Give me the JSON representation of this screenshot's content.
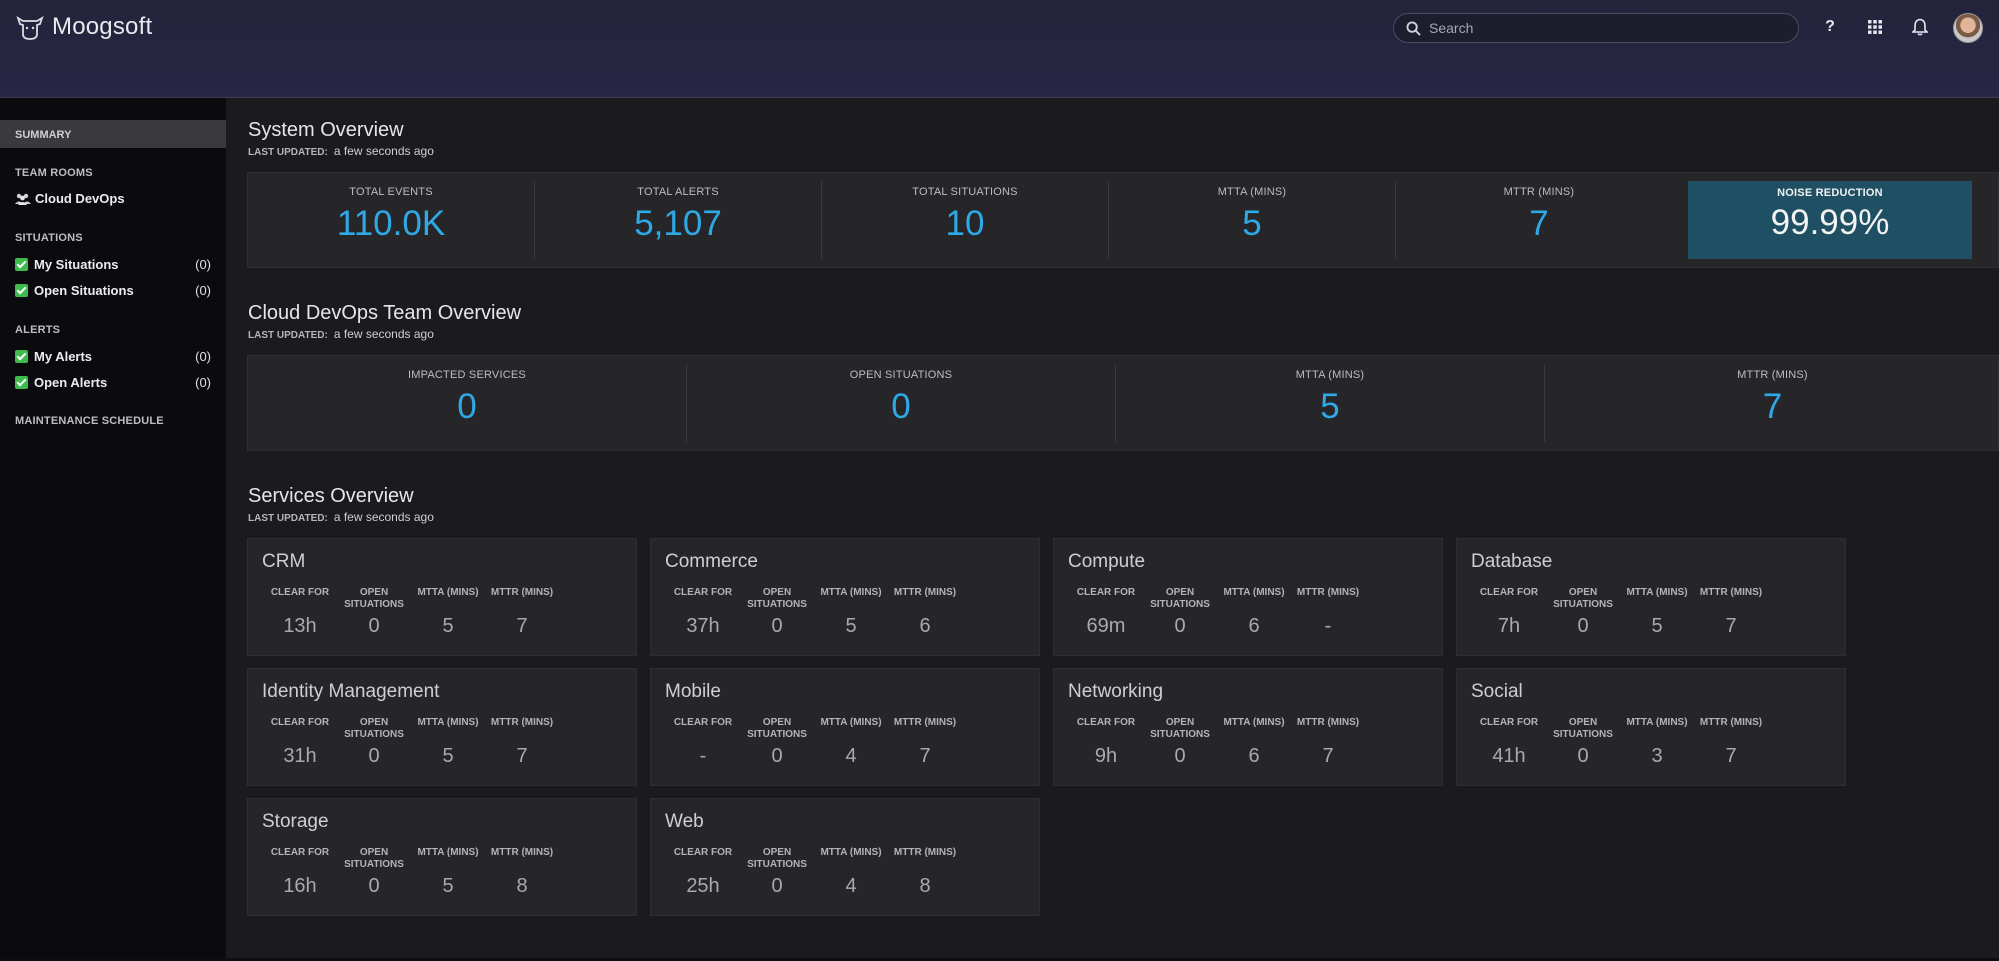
{
  "header": {
    "logo_text": "Moogsoft",
    "search_placeholder": "Search",
    "help_label": "?"
  },
  "sidebar": {
    "summary": "SUMMARY",
    "team_rooms_heading": "TEAM ROOMS",
    "team_room": "Cloud DevOps",
    "situations_heading": "SITUATIONS",
    "situations": [
      {
        "label": "My Situations",
        "count": "(0)"
      },
      {
        "label": "Open Situations",
        "count": "(0)"
      }
    ],
    "alerts_heading": "ALERTS",
    "alerts": [
      {
        "label": "My Alerts",
        "count": "(0)"
      },
      {
        "label": "Open Alerts",
        "count": "(0)"
      }
    ],
    "maintenance": "MAINTENANCE SCHEDULE"
  },
  "system_overview": {
    "title": "System Overview",
    "updated_label": "LAST UPDATED:",
    "updated_value": "a few seconds ago",
    "kpis": [
      {
        "label": "TOTAL EVENTS",
        "value": "110.0K"
      },
      {
        "label": "TOTAL ALERTS",
        "value": "5,107"
      },
      {
        "label": "TOTAL SITUATIONS",
        "value": "10"
      },
      {
        "label": "MTTA (MINS)",
        "value": "5"
      },
      {
        "label": "MTTR (MINS)",
        "value": "7"
      },
      {
        "label": "NOISE REDUCTION",
        "value": "99.99%"
      }
    ]
  },
  "team_overview": {
    "title": "Cloud DevOps Team Overview",
    "updated_label": "LAST UPDATED:",
    "updated_value": "a few seconds ago",
    "kpis": [
      {
        "label": "IMPACTED SERVICES",
        "value": "0"
      },
      {
        "label": "OPEN SITUATIONS",
        "value": "0"
      },
      {
        "label": "MTTA (MINS)",
        "value": "5"
      },
      {
        "label": "MTTR (MINS)",
        "value": "7"
      }
    ]
  },
  "services_overview": {
    "title": "Services Overview",
    "updated_label": "LAST UPDATED:",
    "updated_value": "a few seconds ago",
    "col_labels": [
      "CLEAR FOR",
      "OPEN SITUATIONS",
      "MTTA (MINS)",
      "MTTR (MINS)"
    ],
    "services": [
      {
        "name": "CRM",
        "values": [
          "13h",
          "0",
          "5",
          "7"
        ]
      },
      {
        "name": "Commerce",
        "values": [
          "37h",
          "0",
          "5",
          "6"
        ]
      },
      {
        "name": "Compute",
        "values": [
          "69m",
          "0",
          "6",
          "-"
        ]
      },
      {
        "name": "Database",
        "values": [
          "7h",
          "0",
          "5",
          "7"
        ]
      },
      {
        "name": "Identity Management",
        "values": [
          "31h",
          "0",
          "5",
          "7"
        ]
      },
      {
        "name": "Mobile",
        "values": [
          "-",
          "0",
          "4",
          "7"
        ]
      },
      {
        "name": "Networking",
        "values": [
          "9h",
          "0",
          "6",
          "7"
        ]
      },
      {
        "name": "Social",
        "values": [
          "41h",
          "0",
          "3",
          "7"
        ]
      },
      {
        "name": "Storage",
        "values": [
          "16h",
          "0",
          "5",
          "8"
        ]
      },
      {
        "name": "Web",
        "values": [
          "25h",
          "0",
          "4",
          "8"
        ]
      }
    ]
  }
}
